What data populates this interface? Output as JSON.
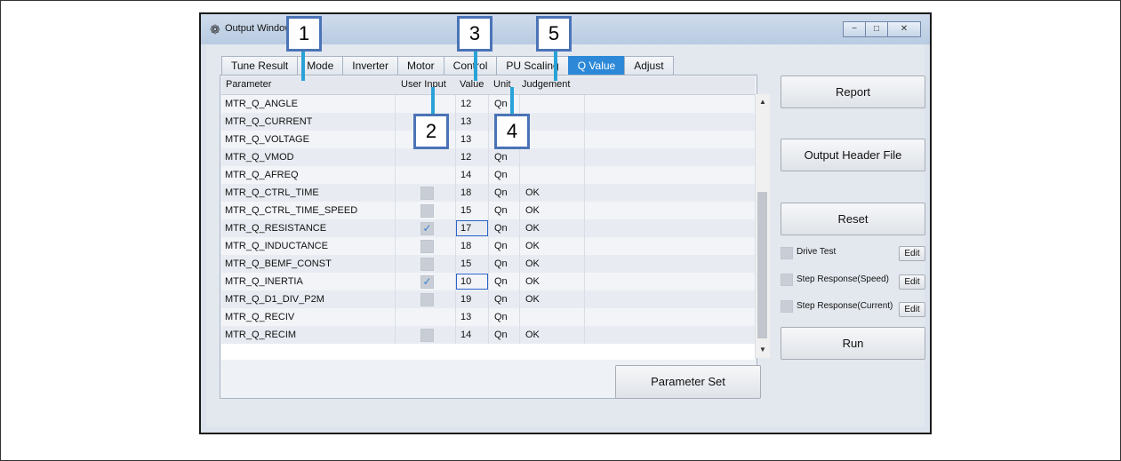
{
  "window": {
    "title": "Output Window"
  },
  "title_buttons": [
    "−",
    "□",
    "✕"
  ],
  "tabs": [
    "Tune Result",
    "Mode",
    "Inverter",
    "Motor",
    "Control",
    "PU Scaling",
    "Q Value",
    "Adjust"
  ],
  "active_tab": "Q Value",
  "grid": {
    "columns": [
      "Parameter",
      "User Input",
      "Value",
      "Unit",
      "Judgement"
    ],
    "rows": [
      {
        "param": "MTR_Q_ANGLE",
        "checkbox": false,
        "checked": false,
        "value": "12",
        "unit": "Qn",
        "judgement": ""
      },
      {
        "param": "MTR_Q_CURRENT",
        "checkbox": false,
        "checked": false,
        "value": "13",
        "unit": "",
        "judgement": ""
      },
      {
        "param": "MTR_Q_VOLTAGE",
        "checkbox": false,
        "checked": false,
        "value": "13",
        "unit": "",
        "judgement": ""
      },
      {
        "param": "MTR_Q_VMOD",
        "checkbox": false,
        "checked": false,
        "value": "12",
        "unit": "Qn",
        "judgement": ""
      },
      {
        "param": "MTR_Q_AFREQ",
        "checkbox": false,
        "checked": false,
        "value": "14",
        "unit": "Qn",
        "judgement": ""
      },
      {
        "param": "MTR_Q_CTRL_TIME",
        "checkbox": true,
        "checked": false,
        "value": "18",
        "unit": "Qn",
        "judgement": "OK"
      },
      {
        "param": "MTR_Q_CTRL_TIME_SPEED",
        "checkbox": true,
        "checked": false,
        "value": "15",
        "unit": "Qn",
        "judgement": "OK"
      },
      {
        "param": "MTR_Q_RESISTANCE",
        "checkbox": true,
        "checked": true,
        "value": "17",
        "unit": "Qn",
        "judgement": "OK",
        "selected": true
      },
      {
        "param": "MTR_Q_INDUCTANCE",
        "checkbox": true,
        "checked": false,
        "value": "18",
        "unit": "Qn",
        "judgement": "OK"
      },
      {
        "param": "MTR_Q_BEMF_CONST",
        "checkbox": true,
        "checked": false,
        "value": "15",
        "unit": "Qn",
        "judgement": "OK"
      },
      {
        "param": "MTR_Q_INERTIA",
        "checkbox": true,
        "checked": true,
        "value": "10",
        "unit": "Qn",
        "judgement": "OK",
        "selected": true
      },
      {
        "param": "MTR_Q_D1_DIV_P2M",
        "checkbox": true,
        "checked": false,
        "value": "19",
        "unit": "Qn",
        "judgement": "OK"
      },
      {
        "param": "MTR_Q_RECIV",
        "checkbox": false,
        "checked": false,
        "value": "13",
        "unit": "Qn",
        "judgement": ""
      },
      {
        "param": "MTR_Q_RECIM",
        "checkbox": true,
        "checked": false,
        "value": "14",
        "unit": "Qn",
        "judgement": "OK"
      }
    ]
  },
  "buttons": {
    "report": "Report",
    "output_header": "Output Header File",
    "reset": "Reset",
    "run": "Run",
    "parameter_set": "Parameter Set"
  },
  "options": [
    {
      "label": "Drive Test",
      "edit": "Edit"
    },
    {
      "label": "Step Response(Speed)",
      "edit": "Edit"
    },
    {
      "label": "Step Response(Current)",
      "edit": "Edit"
    }
  ],
  "callouts": [
    "1",
    "2",
    "3",
    "4",
    "5"
  ],
  "colors": {
    "active_tab": "#2d89d8",
    "callout_border": "#4b74b7",
    "leader": "#2aa2d8"
  }
}
